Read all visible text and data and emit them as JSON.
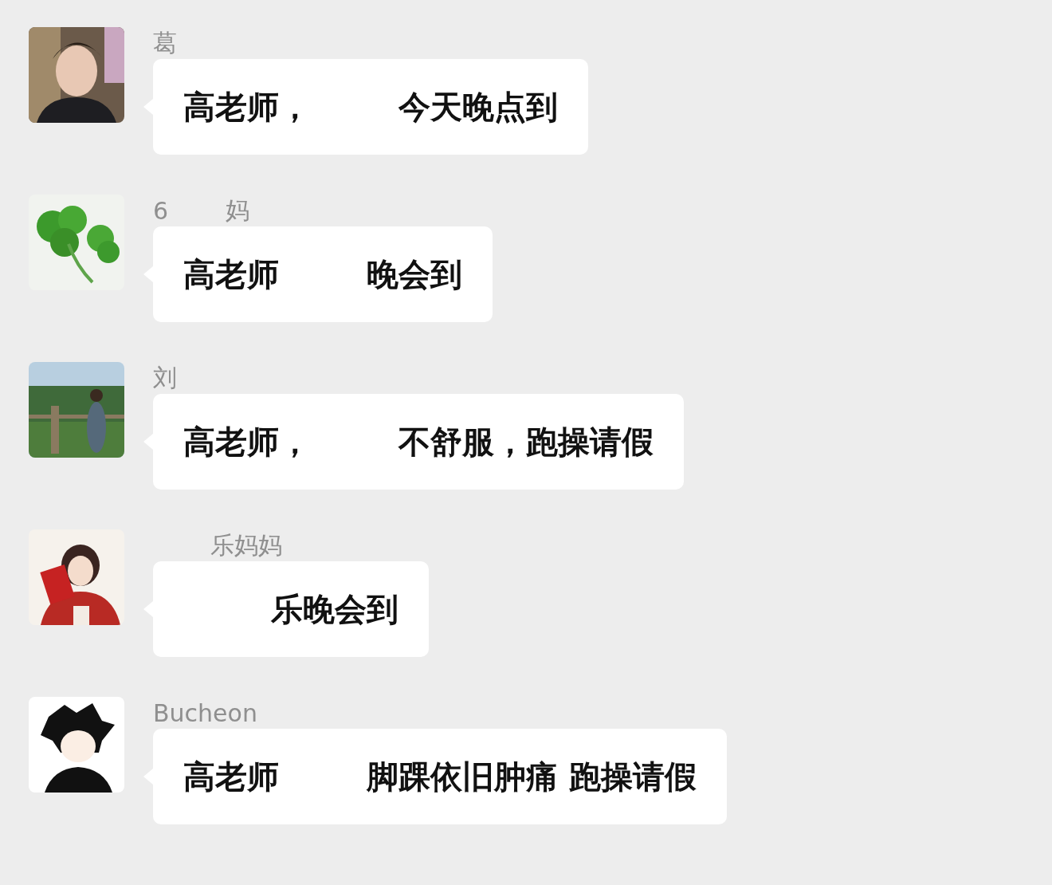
{
  "messages": [
    {
      "avatar": {
        "kind": "picture"
      },
      "name": "葛",
      "segments": [
        {
          "kind": "text",
          "text": "高老师，"
        },
        {
          "kind": "redacted"
        },
        {
          "kind": "text",
          "text": "今天晚点到"
        }
      ]
    },
    {
      "avatar": {
        "kind": "picture"
      },
      "name": "6",
      "name_tail": "妈",
      "segments": [
        {
          "kind": "text",
          "text": "高老师"
        },
        {
          "kind": "redacted"
        },
        {
          "kind": "text",
          "text": "晚会到"
        }
      ]
    },
    {
      "avatar": {
        "kind": "picture"
      },
      "name": "刘",
      "segments": [
        {
          "kind": "text",
          "text": "高老师，"
        },
        {
          "kind": "redacted"
        },
        {
          "kind": "text",
          "text": "不舒服，跑操请假"
        }
      ]
    },
    {
      "avatar": {
        "kind": "picture"
      },
      "name_tail": "乐妈妈",
      "segments": [
        {
          "kind": "redacted"
        },
        {
          "kind": "text",
          "text": "乐晚会到"
        }
      ]
    },
    {
      "avatar": {
        "kind": "picture"
      },
      "name": "Bucheon",
      "segments": [
        {
          "kind": "text",
          "text": "高老师"
        },
        {
          "kind": "redacted"
        },
        {
          "kind": "text",
          "text": "脚踝依旧肿痛 跑操请假"
        }
      ]
    }
  ]
}
